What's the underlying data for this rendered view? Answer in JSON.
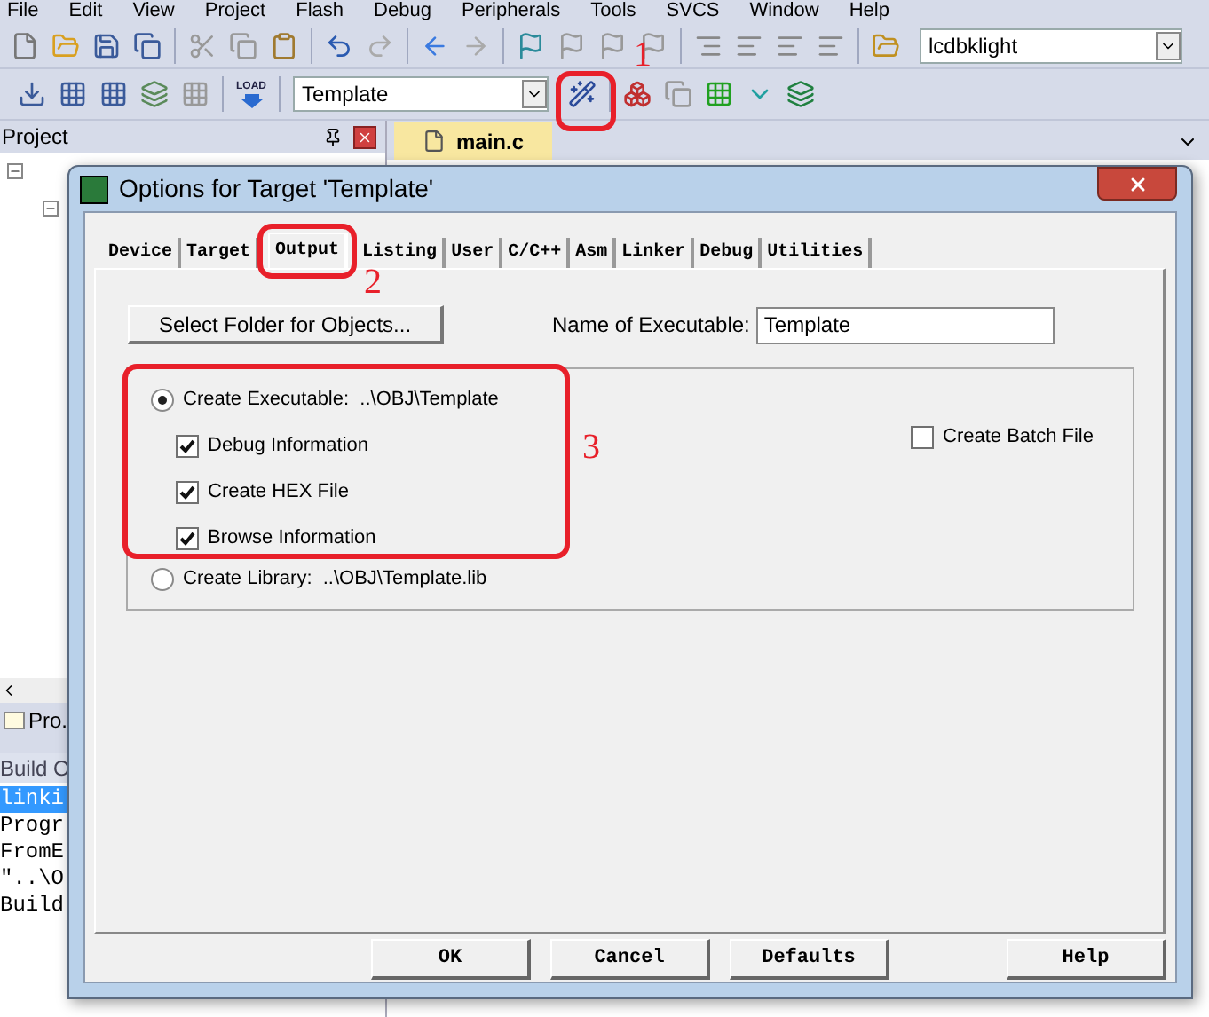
{
  "menu": [
    "File",
    "Edit",
    "View",
    "Project",
    "Flash",
    "Debug",
    "Peripherals",
    "Tools",
    "SVCS",
    "Window",
    "Help"
  ],
  "toolbar": {
    "file_combo": "lcdbklight",
    "load_label": "LOAD",
    "target_combo": "Template"
  },
  "project_pane": {
    "title": "Project"
  },
  "editor_tabs": [
    {
      "label": "main.c",
      "selected": true
    }
  ],
  "bottom_pane": {
    "tab": "Pro.",
    "title": "Build O",
    "lines": [
      {
        "text": "linki",
        "selected": true
      },
      {
        "text": "Progr",
        "selected": false
      },
      {
        "text": "FromE",
        "selected": false
      },
      {
        "text": "\"..\\O",
        "selected": false
      },
      {
        "text": "Build",
        "selected": false
      }
    ]
  },
  "dialog": {
    "title": "Options for Target 'Template'",
    "tabs": [
      {
        "label": "Device",
        "selected": false
      },
      {
        "label": "Target",
        "selected": false
      },
      {
        "label": "Output",
        "selected": true
      },
      {
        "label": "Listing",
        "selected": false
      },
      {
        "label": "User",
        "selected": false
      },
      {
        "label": "C/C++",
        "selected": false
      },
      {
        "label": "Asm",
        "selected": false
      },
      {
        "label": "Linker",
        "selected": false
      },
      {
        "label": "Debug",
        "selected": false
      },
      {
        "label": "Utilities",
        "selected": false
      }
    ],
    "select_folder_button": "Select Folder for Objects...",
    "name_label": "Name of Executable:",
    "name_value": "Template",
    "options": [
      {
        "kind": "radio",
        "label": "Create Executable:  ..\\OBJ\\Template",
        "selected": true,
        "children": [
          {
            "kind": "checkbox",
            "label": "Debug Information",
            "checked": true
          },
          {
            "kind": "checkbox",
            "label": "Create HEX File",
            "checked": true
          },
          {
            "kind": "checkbox",
            "label": "Browse Information",
            "checked": true
          }
        ]
      },
      {
        "kind": "radio",
        "label": "Create Library:  ..\\OBJ\\Template.lib",
        "selected": false
      }
    ],
    "batch_file": {
      "label": "Create Batch File",
      "checked": false
    },
    "buttons": [
      "OK",
      "Cancel",
      "Defaults",
      "Help"
    ]
  },
  "annotations": [
    {
      "label": "1"
    },
    {
      "label": "2"
    },
    {
      "label": "3"
    }
  ]
}
